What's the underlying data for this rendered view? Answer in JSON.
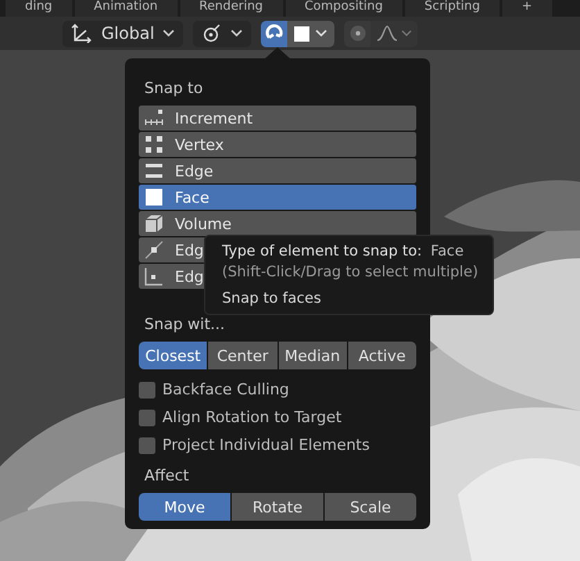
{
  "workspace_tabs": [
    {
      "label": "ding",
      "selected": false
    },
    {
      "label": "Animation",
      "selected": false
    },
    {
      "label": "Rendering",
      "selected": false
    },
    {
      "label": "Compositing",
      "selected": false
    },
    {
      "label": "Scripting",
      "selected": false
    },
    {
      "label": "+",
      "selected": false
    }
  ],
  "header": {
    "orientation": "Global",
    "snap_on": true,
    "proportional_on": false
  },
  "popup": {
    "snap_to_title": "Snap to",
    "elements": [
      {
        "kind": "increment",
        "label": "Increment",
        "selected": false
      },
      {
        "kind": "vertex",
        "label": "Vertex",
        "selected": false
      },
      {
        "kind": "edge",
        "label": "Edge",
        "selected": false
      },
      {
        "kind": "face",
        "label": "Face",
        "selected": true
      },
      {
        "kind": "volume",
        "label": "Volume",
        "selected": false
      },
      {
        "kind": "edge_center",
        "label": "Edg",
        "selected": false
      },
      {
        "kind": "edge_perp",
        "label": "Edg",
        "selected": false
      }
    ],
    "snap_with_title": "Snap wit...",
    "snap_with": [
      {
        "label": "Closest",
        "selected": true
      },
      {
        "label": "Center",
        "selected": false
      },
      {
        "label": "Median",
        "selected": false
      },
      {
        "label": "Active",
        "selected": false
      }
    ],
    "options": [
      {
        "label": "Backface Culling",
        "checked": false
      },
      {
        "label": "Align Rotation to Target",
        "checked": false
      },
      {
        "label": "Project Individual Elements",
        "checked": false
      }
    ],
    "affect_title": "Affect",
    "affect": [
      {
        "label": "Move",
        "selected": true
      },
      {
        "label": "Rotate",
        "selected": false
      },
      {
        "label": "Scale",
        "selected": false
      }
    ]
  },
  "tooltip": {
    "title": "Type of element to snap to:",
    "value": "Face",
    "hint": "(Shift-Click/Drag to select multiple)",
    "description": "Snap to faces"
  }
}
